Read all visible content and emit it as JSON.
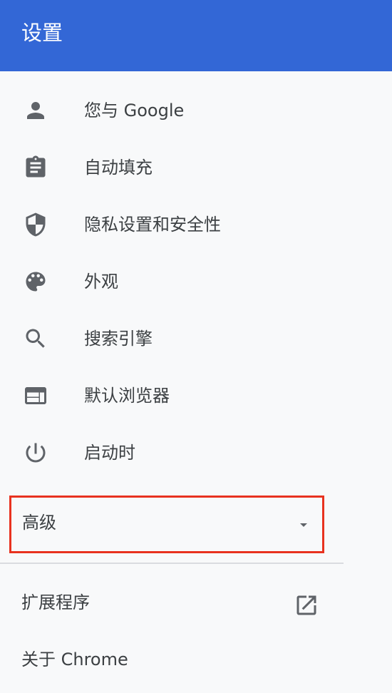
{
  "header": {
    "title": "设置",
    "color": "#3367d6"
  },
  "nav": {
    "items": [
      {
        "label": "您与 Google",
        "icon": "person-icon"
      },
      {
        "label": "自动填充",
        "icon": "clipboard-icon"
      },
      {
        "label": "隐私设置和安全性",
        "icon": "shield-icon"
      },
      {
        "label": "外观",
        "icon": "palette-icon"
      },
      {
        "label": "搜索引擎",
        "icon": "search-icon"
      },
      {
        "label": "默认浏览器",
        "icon": "browser-window-icon"
      },
      {
        "label": "启动时",
        "icon": "power-icon"
      }
    ],
    "advanced": {
      "label": "高级",
      "icon": "caret-down-icon",
      "highlight_color": "#e8321f"
    },
    "extensions": {
      "label": "扩展程序",
      "icon": "open-in-new-icon"
    },
    "about": {
      "label": "关于 Chrome"
    }
  }
}
